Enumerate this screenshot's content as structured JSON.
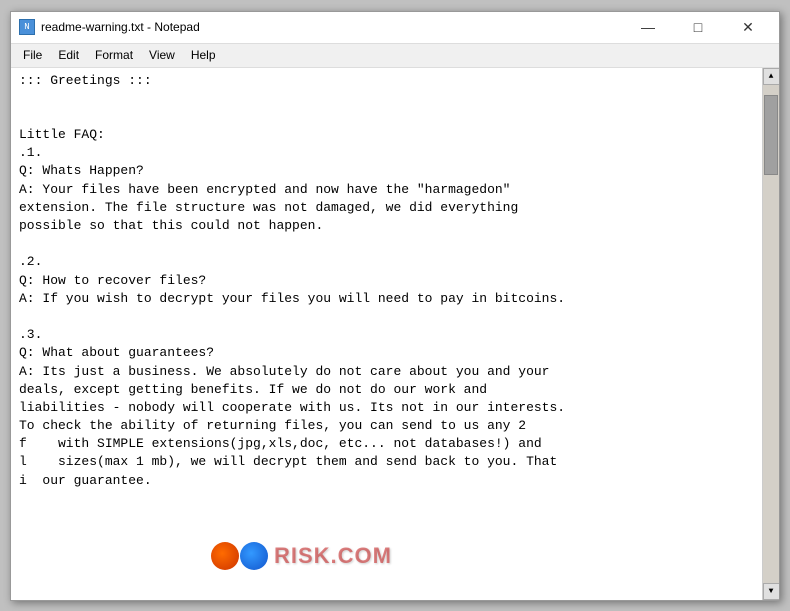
{
  "window": {
    "title": "readme-warning.txt - Notepad",
    "icon_label": "N"
  },
  "title_buttons": {
    "minimize": "—",
    "maximize": "□",
    "close": "✕"
  },
  "menu": {
    "items": [
      "File",
      "Edit",
      "Format",
      "View",
      "Help"
    ]
  },
  "content": {
    "text": "::: Greetings :::\n\n\nLittle FAQ:\n.1.\nQ: Whats Happen?\nA: Your files have been encrypted and now have the \"harmagedon\"\nextension. The file structure was not damaged, we did everything\npossible so that this could not happen.\n\n.2.\nQ: How to recover files?\nA: If you wish to decrypt your files you will need to pay in bitcoins.\n\n.3.\nQ: What about guarantees?\nA: Its just a business. We absolutely do not care about you and your\ndeals, except getting benefits. If we do not do our work and\nliabilities - nobody will cooperate with us. Its not in our interests.\nTo check the ability of returning files, you can send to us any 2\nf    with SIMPLE extensions(jpg,xls,doc, etc... not databases!) and\nl    sizes(max 1 mb), we will decrypt them and send back to you. That\ni  our guarantee."
  },
  "watermark": {
    "text": "RISK.COM"
  }
}
